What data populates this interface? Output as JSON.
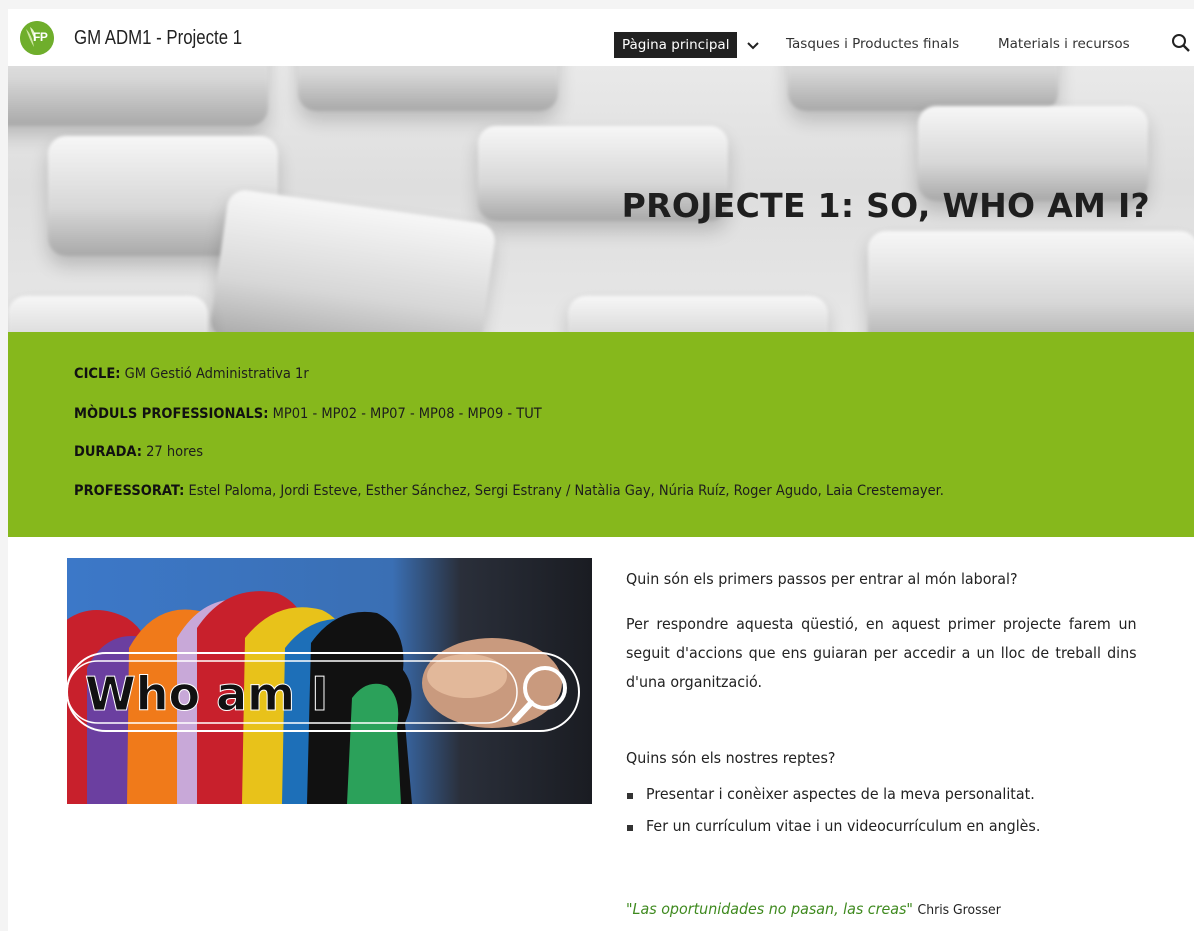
{
  "header": {
    "logo_text": "FP",
    "site_title": "GM ADM1 - Projecte 1",
    "nav": {
      "main": "Pàgina principal",
      "tasques": "Tasques i Productes finals",
      "materials": "Materials i recursos"
    },
    "icons": [
      "chevron-down-icon",
      "search-icon"
    ]
  },
  "hero": {
    "title": "PROJECTE 1: SO, WHO AM I?"
  },
  "info": {
    "cicle_label": "CICLE:",
    "cicle_value": " GM Gestió Administrativa 1r",
    "moduls_label": "MÒDULS PROFESSIONALS:",
    "moduls_value": " MP01 - MP02 - MP07 - MP08 - MP09 - TUT",
    "durada_label": "DURADA:",
    "durada_value": " 27 hores",
    "professorat_label": "PROFESSORAT:",
    "professorat_value": " Estel Paloma, Jordi Esteve, Esther Sánchez, Sergi Estrany / Natàlia Gay, Núria Ruíz, Roger Agudo, Laia Crestemayer."
  },
  "content": {
    "image_text": "Who am I",
    "question1": "Quin són els primers passos per entrar al món laboral?",
    "paragraph": "Per respondre aquesta qüestió, en aquest primer projecte farem un seguit d'accions que ens guiaran per accedir a un lloc de treball dins d'una organització.",
    "question2": "Quins són els nostres reptes?",
    "bullets": [
      "Presentar i conèixer aspectes de la meva personalitat.",
      "Fer un currículum vitae i un videocurrículum en anglès."
    ],
    "quote_text": "\"Las oportunidades no pasan, las creas\"",
    "quote_author": "Chris Grosser"
  },
  "colors": {
    "green_band": "#86b81c",
    "nav_active_bg": "#212121",
    "quote_green": "#3f8a1f"
  }
}
